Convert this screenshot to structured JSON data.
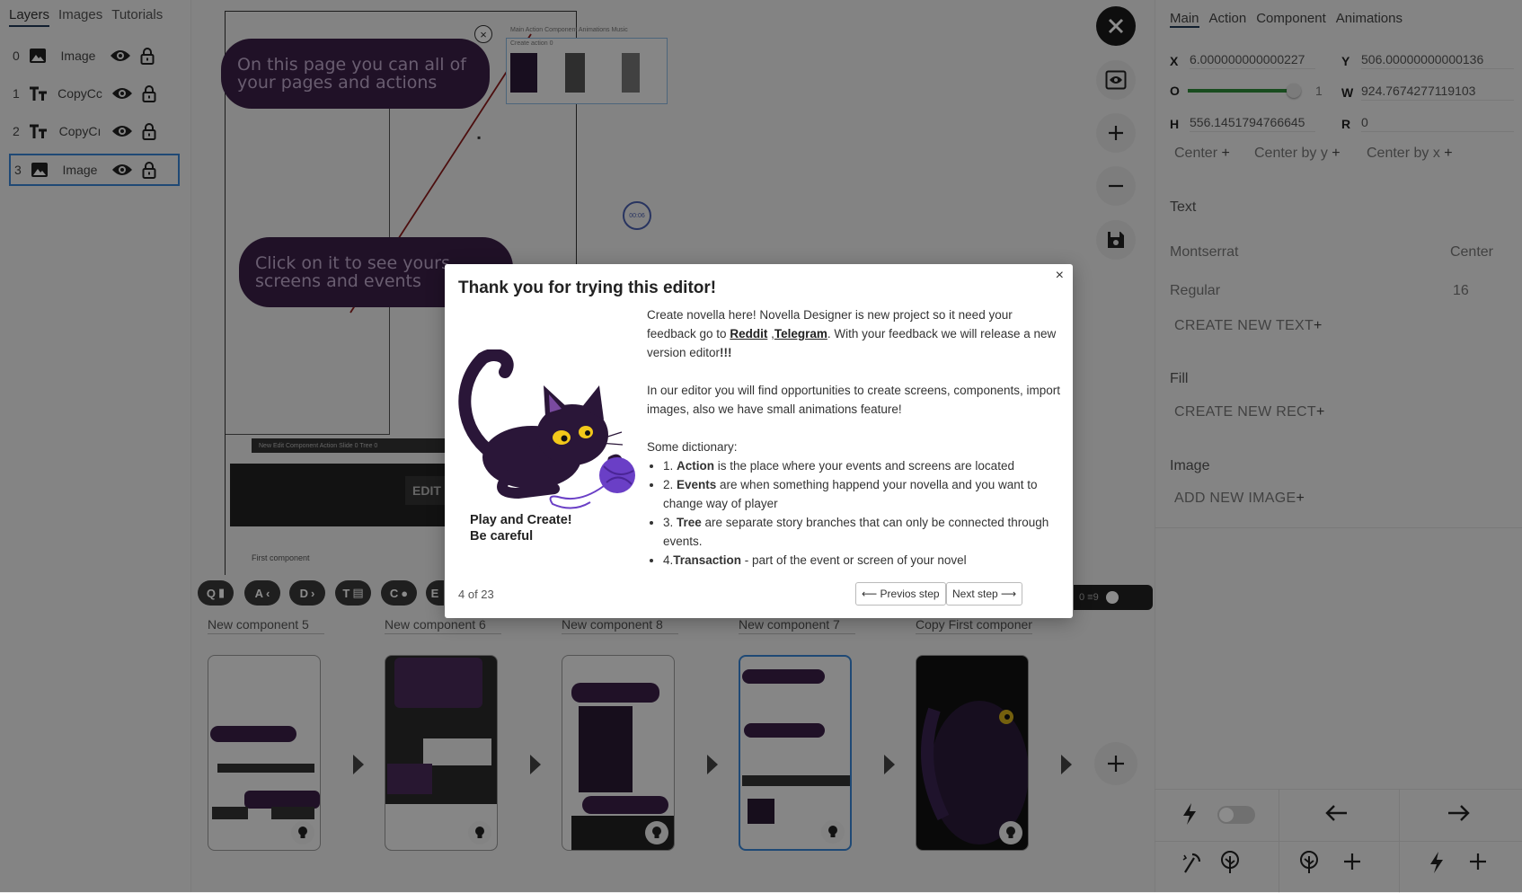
{
  "left": {
    "tabs": [
      {
        "label": "Layers"
      },
      {
        "label": "Images"
      },
      {
        "label": "Tutorials"
      }
    ],
    "layers": [
      {
        "index": "0",
        "name": "Image"
      },
      {
        "index": "1",
        "name": "CopyCc"
      },
      {
        "index": "2",
        "name": "CopyCı"
      },
      {
        "index": "3",
        "name": "Image"
      }
    ]
  },
  "canvas": {
    "bubble1": "On this page you can all of your pages and actions",
    "bubble2": "Click on it to see yours screens and events",
    "mini_tabs": "Main  Action  Component  Animations  Music",
    "mini_action": "Create action 0",
    "toolbar_strip": "New Edit Component Action  Slide 0  Tree 0",
    "edit_label": "EDIT",
    "first_component": "First component",
    "timer": "00:06",
    "strip_counts": "0  ≡9"
  },
  "tools": [
    {
      "letter": "Q",
      "glyph": "▮"
    },
    {
      "letter": "A",
      "glyph": "‹"
    },
    {
      "letter": "D",
      "glyph": "›"
    },
    {
      "letter": "T",
      "glyph": "▤"
    },
    {
      "letter": "C",
      "glyph": "●"
    },
    {
      "letter": "E",
      "glyph": ""
    }
  ],
  "screens": [
    {
      "label": "New component 5"
    },
    {
      "label": "New component 6"
    },
    {
      "label": "New component 8"
    },
    {
      "label": "New component 7"
    },
    {
      "label": "Copy First component"
    }
  ],
  "right": {
    "tabs": [
      {
        "label": "Main"
      },
      {
        "label": "Action"
      },
      {
        "label": "Component"
      },
      {
        "label": "Animations"
      }
    ],
    "x_label": "X",
    "x_value": "6.000000000000227",
    "y_label": "Y",
    "y_value": "506.00000000000136",
    "o_label": "O",
    "o_value": "1",
    "o_fraction": 0.95,
    "w_label": "W",
    "w_value": "924.7674277119103",
    "h_label": "H",
    "h_value": "556.1451794766645",
    "r_label": "R",
    "r_value": "0",
    "center": "Center",
    "center_y": "Center by y",
    "center_x": "Center by x",
    "text_title": "Text",
    "font_family": "Montserrat",
    "text_align": "Center",
    "font_weight": "Regular",
    "font_size": "16",
    "create_text": "CREATE NEW TEXT",
    "fill_title": "Fill",
    "create_rect": "CREATE NEW RECT",
    "image_title": "Image",
    "add_image": "ADD NEW IMAGE"
  },
  "modal": {
    "title": "Thank you for trying this editor!",
    "close": "×",
    "p1_a": "Create novella here! Novella Designer is new project so it need your feedback go to ",
    "reddit": "Reddit",
    "comma": " ,",
    "telegram": "Telegram",
    "p1_b": ". With your feedback we will release a new version editor",
    "p1_bang": "!!!",
    "p2": "In our editor you will find opportunities to create screens, components, import images, also we have small animations feature!",
    "dict_title": "Some dictionary:",
    "items": [
      {
        "num": "1. ",
        "term": "Action",
        "rest": " is the place where your events and screens are located"
      },
      {
        "num": "2. ",
        "term": "Events",
        "rest": " are when something happend your novella and you want to change way of player"
      },
      {
        "num": "3. ",
        "term": "Tree",
        "rest": " are separate story branches that can only be connected through events."
      },
      {
        "num": "4.",
        "term": "Transaction",
        "rest": " - part of the event or screen of your novel"
      }
    ],
    "caption_1": "Play and Create!",
    "caption_2": "Be careful",
    "counter": "4 of 23",
    "prev": "⟵ Previos step",
    "next": "Next step ⟶"
  },
  "colors": {
    "accent": "#3a86d6",
    "bubble": "#3b1f48",
    "cat": "#2a1638",
    "yarn": "#6a3fc6"
  }
}
